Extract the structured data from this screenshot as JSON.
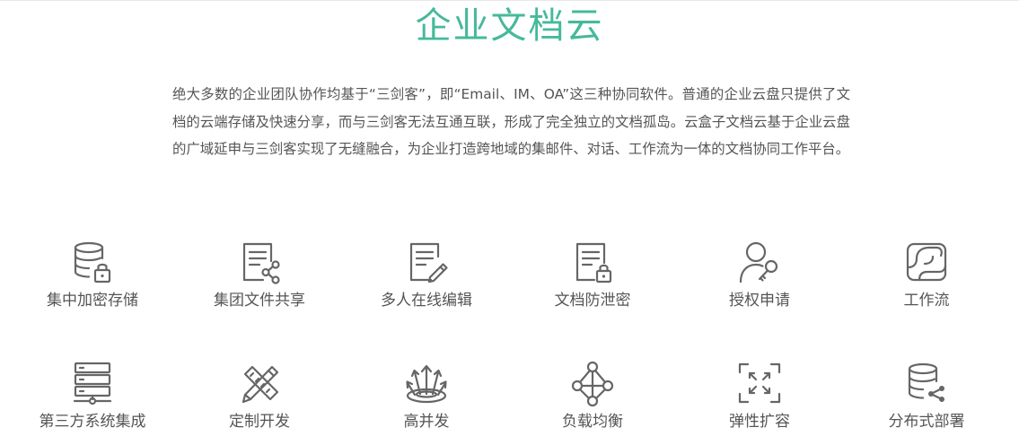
{
  "section": {
    "title": "企业文档云",
    "intro": "绝大多数的企业团队协作均基于“三剑客”，即“Email、IM、OA”这三种协同软件。普通的企业云盘只提供了文档的云端存储及快速分享，而与三剑客无法互通互联，形成了完全独立的文档孤岛。云盒子文档云基于企业云盘的广域延申与三剑客实现了无缝融合，为企业打造跨地域的集邮件、对话、工作流为一体的文档协同工作平台。"
  },
  "features": [
    {
      "label": "集中加密存储",
      "icon": "database-lock-icon"
    },
    {
      "label": "集团文件共享",
      "icon": "document-share-icon"
    },
    {
      "label": "多人在线编辑",
      "icon": "document-edit-icon"
    },
    {
      "label": "文档防泄密",
      "icon": "document-lock-icon"
    },
    {
      "label": "授权申请",
      "icon": "user-key-icon"
    },
    {
      "label": "工作流",
      "icon": "workflow-icon"
    },
    {
      "label": "第三方系统集成",
      "icon": "server-stack-icon"
    },
    {
      "label": "定制开发",
      "icon": "pencil-ruler-icon"
    },
    {
      "label": "高并发",
      "icon": "concurrency-arrows-icon"
    },
    {
      "label": "负载均衡",
      "icon": "load-balance-icon"
    },
    {
      "label": "弹性扩容",
      "icon": "expand-icon"
    },
    {
      "label": "分布式部署",
      "icon": "database-share-icon"
    }
  ],
  "colors": {
    "title": "#46b99b",
    "text": "#555555",
    "icon": "#666666"
  }
}
